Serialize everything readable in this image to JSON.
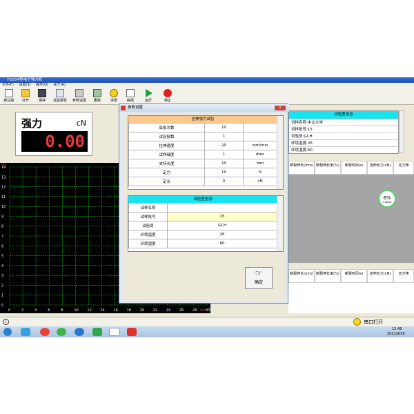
{
  "window": {
    "title": "YG004型电子强力机"
  },
  "menu": [
    "文件(F)",
    "设置(S)",
    "操作(O)",
    "关于(A)"
  ],
  "toolbar": [
    "新试验",
    "打开",
    "保存",
    "试验报告",
    "参数设置",
    "删除",
    "清零",
    "曲线",
    "运行",
    "停止"
  ],
  "force": {
    "label": "强力",
    "unit": "cN",
    "value": "0.00"
  },
  "chart": {
    "y_ticks": [
      "14",
      "13",
      "12",
      "11",
      "10",
      "9",
      "8",
      "7",
      "6",
      "5",
      "4",
      "3",
      "2",
      "1",
      "0"
    ],
    "y_unit": "cN",
    "x_ticks": [
      "0",
      "2",
      "4",
      "6",
      "8",
      "10",
      "12",
      "14",
      "16",
      "18",
      "20",
      "22",
      "24",
      "26",
      "28",
      "30"
    ],
    "x_unit": "mm"
  },
  "right_info": {
    "header": "试验室信息",
    "rows": [
      "试样名称:中山大学",
      "试样批号:15",
      "试验员:GCH",
      "环境温度:26",
      "环境湿度:60"
    ]
  },
  "result_cols": [
    "断裂伸长(mm)",
    "断裂伸长率(%)",
    "断裂时间(s)",
    "定伸长力(cN)",
    "定力伸"
  ],
  "progress": {
    "label": "6%",
    "sub": "7.0Kb/s"
  },
  "dialog": {
    "title": "参数设置",
    "close": "X",
    "group1_title": "拉伸强力试验",
    "group1_rows": [
      [
        "每批次数",
        "10",
        ""
      ],
      [
        "试验批数",
        "1",
        ""
      ],
      [
        "拉伸速度",
        "20",
        "mm/min"
      ],
      [
        "试样细度",
        "1",
        "dtex"
      ],
      [
        "夹持长度",
        "10",
        "mm"
      ],
      [
        "定力",
        "10",
        "%"
      ],
      [
        "定长",
        "0",
        "cN"
      ]
    ],
    "group2_title": "试验室信息",
    "group2_rows": [
      [
        "试样名称",
        ""
      ],
      [
        "试样批号",
        "15"
      ],
      [
        "试验员",
        "GCH"
      ],
      [
        "环境温度",
        "26"
      ],
      [
        "环境湿度",
        "60"
      ]
    ],
    "ok_label": "确定"
  },
  "status": {
    "port": "串口打开"
  },
  "clock": {
    "time": "15:48",
    "date": "2021/9/26"
  },
  "colors": {
    "header_orange": "#fbc98f",
    "header_cyan": "#19e3ef",
    "grid": "#1fae1f",
    "digit": "#e8383a",
    "input_yellow": "#ffffcc"
  }
}
